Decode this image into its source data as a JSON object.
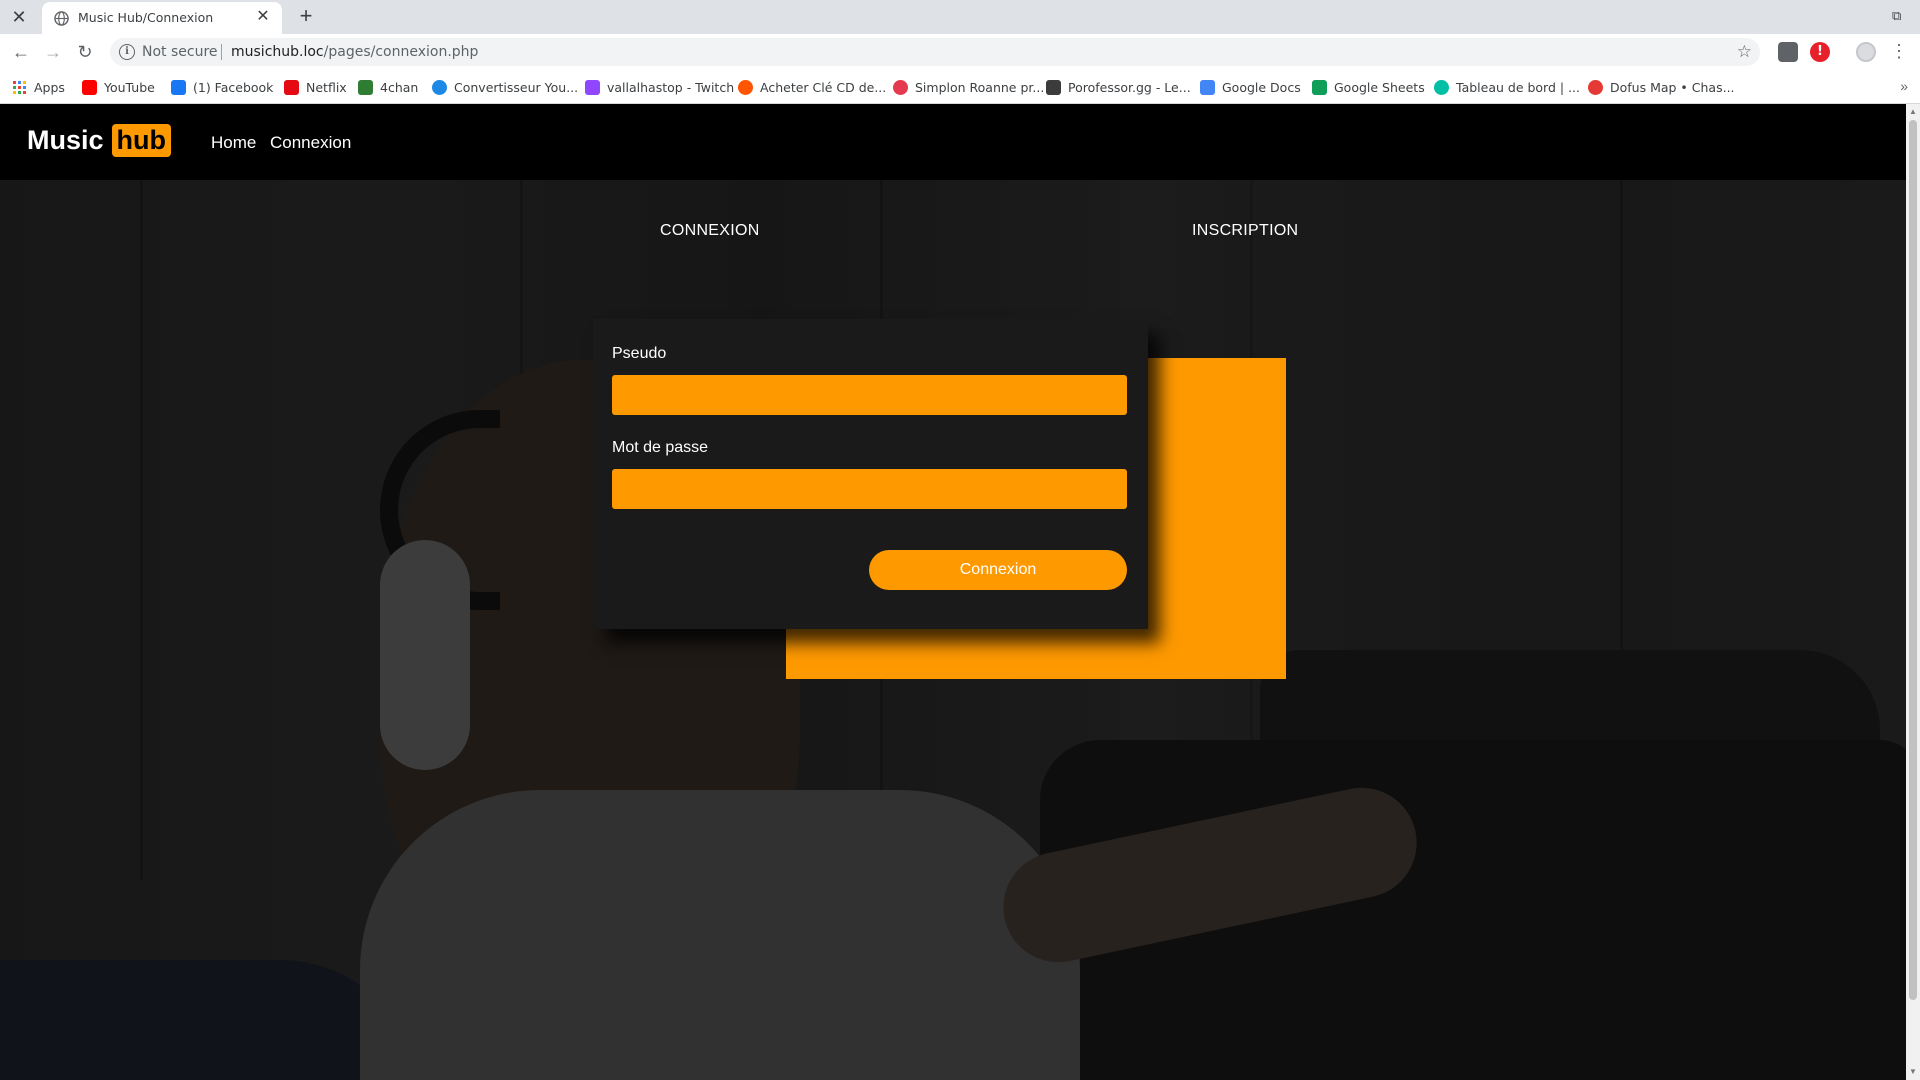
{
  "browser": {
    "tab": {
      "title": "Music Hub/Connexion"
    },
    "omnibox": {
      "security": "Not secure",
      "host": "musichub.loc",
      "path": "/pages/connexion.php"
    },
    "bookmarks": [
      {
        "label": "Apps",
        "icon": "apps-grid-icon",
        "color": "#1a73e8"
      },
      {
        "label": "YouTube",
        "icon": "youtube-icon",
        "color": "#ff0000"
      },
      {
        "label": "(1) Facebook",
        "icon": "facebook-icon",
        "color": "#1877f2"
      },
      {
        "label": "Netflix",
        "icon": "netflix-icon",
        "color": "#e50914"
      },
      {
        "label": "4chan",
        "icon": "4chan-icon",
        "color": "#2e7d32"
      },
      {
        "label": "Convertisseur You...",
        "icon": "converter-icon",
        "color": "#1e88e5"
      },
      {
        "label": "vallalhastop - Twitch",
        "icon": "twitch-icon",
        "color": "#9146ff"
      },
      {
        "label": "Acheter Clé CD de...",
        "icon": "instant-gaming-icon",
        "color": "#ff5400"
      },
      {
        "label": "Simplon Roanne pr...",
        "icon": "simplon-icon",
        "color": "#e53950"
      },
      {
        "label": "Porofessor.gg - Le...",
        "icon": "porofessor-icon",
        "color": "#3b3b3b"
      },
      {
        "label": "Google Docs",
        "icon": "google-docs-icon",
        "color": "#4285f4"
      },
      {
        "label": "Google Sheets",
        "icon": "google-sheets-icon",
        "color": "#0f9d58"
      },
      {
        "label": "Tableau de bord | ...",
        "icon": "dashboard-icon",
        "color": "#00bfa5"
      },
      {
        "label": "Dofus Map • Chas...",
        "icon": "dofus-map-icon",
        "color": "#e53935"
      }
    ]
  },
  "site": {
    "logo": {
      "text": "Music",
      "badge": "hub"
    },
    "nav": [
      {
        "label": "Home"
      },
      {
        "label": "Connexion"
      }
    ],
    "tabs": {
      "login": "CONNEXION",
      "register": "INSCRIPTION"
    },
    "form": {
      "pseudo_label": "Pseudo",
      "pseudo_value": "",
      "password_label": "Mot de passe",
      "password_value": "",
      "submit_label": "Connexion"
    }
  },
  "colors": {
    "accent": "#ff9900",
    "navbar": "#000000",
    "card": "#1a1a1a"
  }
}
